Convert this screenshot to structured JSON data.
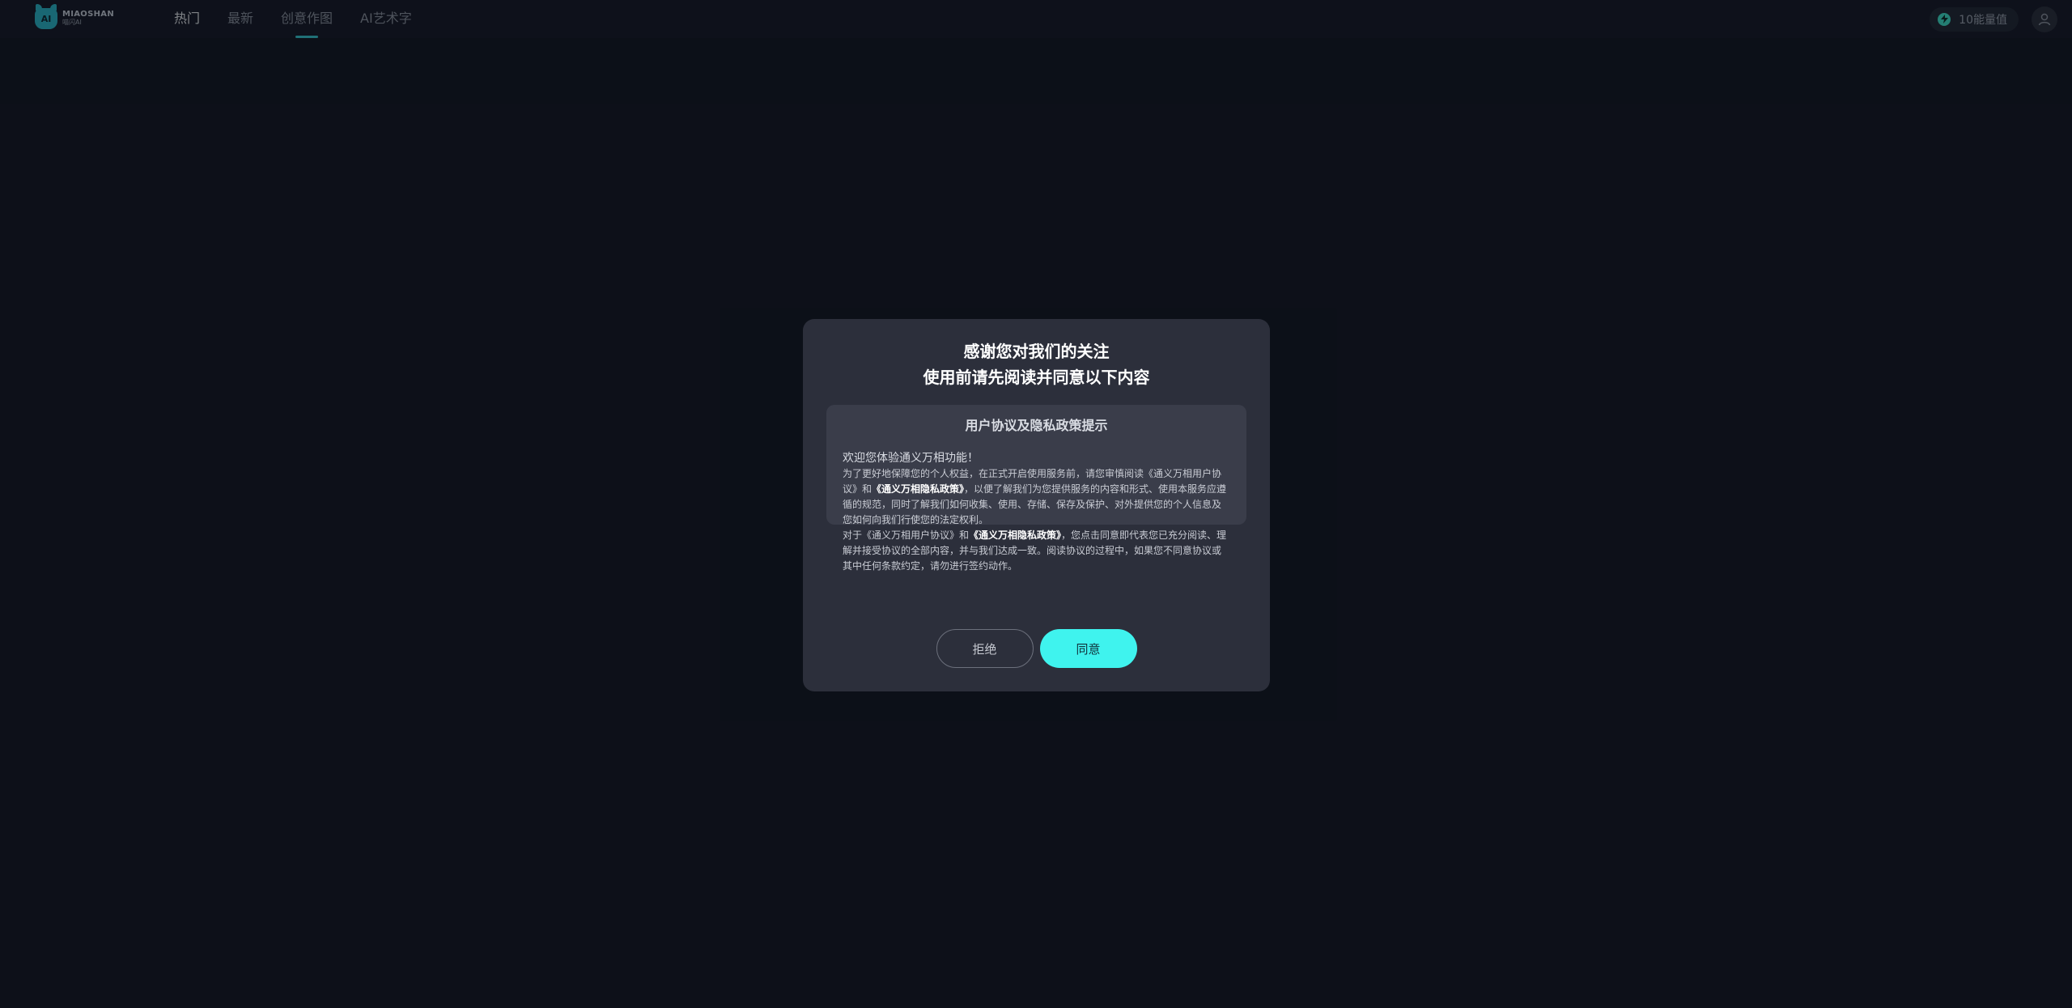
{
  "header": {
    "logo": {
      "line1": "MIAOSHAN",
      "line2": "喵闪AI"
    },
    "nav": [
      "热门",
      "最新",
      "创意作图",
      "AI艺术字"
    ],
    "energy": "10能量值"
  },
  "modal": {
    "title_line1": "感谢您对我们的关注",
    "title_line2": "使用前请先阅读并同意以下内容",
    "box_heading": "用户协议及隐私政策提示",
    "welcome": "欢迎您体验通义万相功能！",
    "p1_a": "为了更好地保障您的个人权益，在正式开启使用服务前，请您审慎阅读《通义万相用户协议》和",
    "p1_bold": "《通义万相隐私政策》",
    "p1_b": "，以便了解我们为您提供服务的内容和形式、使用本服务应遵循的规范，同时了解我们如何收集、使用、存储、保存及保护、对外提供您的个人信息及您如何向我们行使您的法定权利。",
    "p2_a": "对于《通义万相用户协议》和",
    "p2_bold": "《通义万相隐私政策》",
    "p2_b": "，您点击同意即代表您已充分阅读、理解并接受协议的全部内容，并与我们达成一致。阅读协议的过程中，如果您不同意协议或其中任何条款约定，请勿进行签约动作。",
    "reject": "拒绝",
    "agree": "同意"
  },
  "colors": {
    "accent": "#3ff3ee",
    "nav_underline": "#37c7d0",
    "modal_bg": "#2c2f3b",
    "page_bg": "#131824"
  },
  "icons": [
    "logo-icon",
    "energy-icon",
    "user-avatar-icon"
  ]
}
